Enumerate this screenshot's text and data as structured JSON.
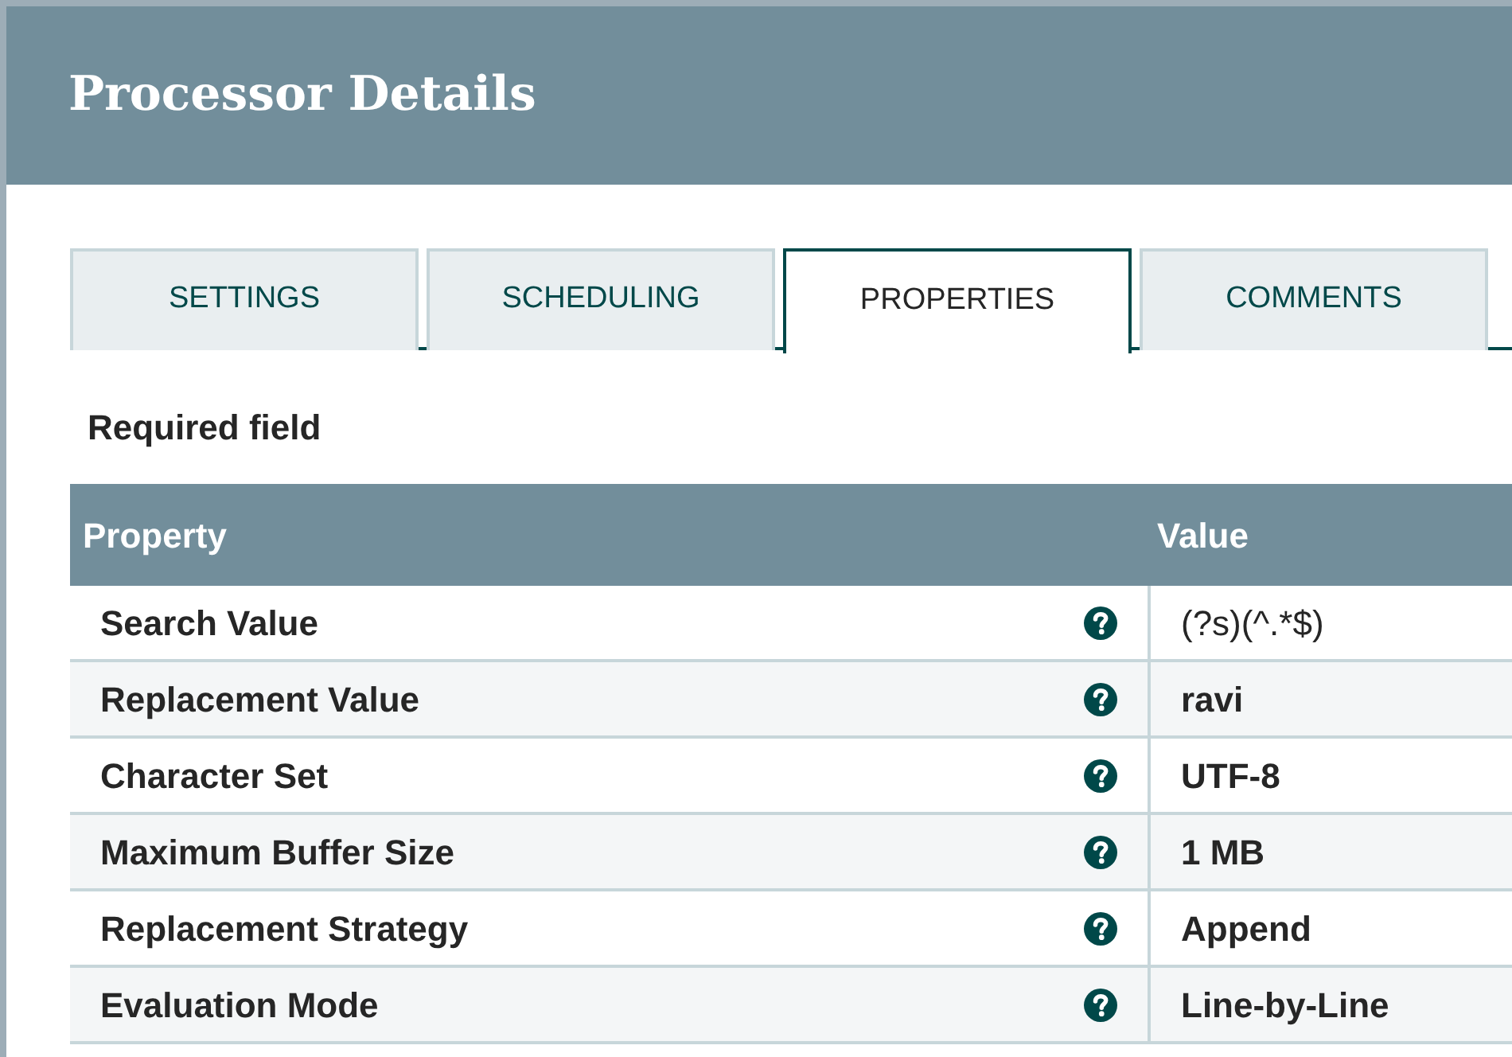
{
  "window": {
    "title": "Processor Details"
  },
  "tabs": [
    {
      "label": "SETTINGS",
      "selected": false
    },
    {
      "label": "SCHEDULING",
      "selected": false
    },
    {
      "label": "PROPERTIES",
      "selected": true
    },
    {
      "label": "COMMENTS",
      "selected": false
    }
  ],
  "required_note": "Required field",
  "table": {
    "columns": [
      "Property",
      "Value"
    ],
    "rows": [
      {
        "property": "Search Value",
        "value": "(?s)(^.*$)",
        "value_bold": false
      },
      {
        "property": "Replacement Value",
        "value": "ravi",
        "value_bold": true
      },
      {
        "property": "Character Set",
        "value": "UTF-8",
        "value_bold": true
      },
      {
        "property": "Maximum Buffer Size",
        "value": "1 MB",
        "value_bold": true
      },
      {
        "property": "Replacement Strategy",
        "value": "Append",
        "value_bold": true
      },
      {
        "property": "Evaluation Mode",
        "value": "Line-by-Line",
        "value_bold": true
      }
    ]
  }
}
